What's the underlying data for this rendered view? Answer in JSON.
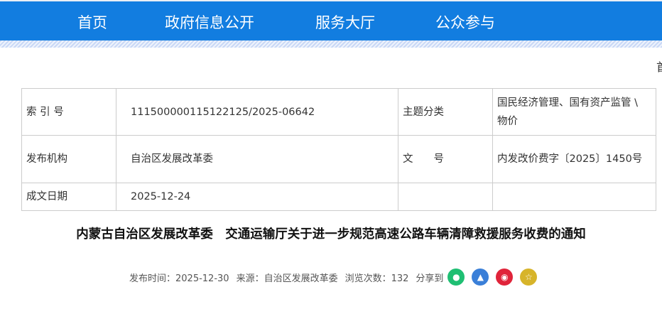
{
  "nav": [
    "首页",
    "政府信息公开",
    "服务大厅",
    "公众参与"
  ],
  "breadcrumb": "首",
  "info": {
    "index_label": "索 引 号",
    "index_value": "11150000011512212​5/2025-06642",
    "topic_label": "主题分类",
    "topic_value": "国民经济管理、国有资产监管 \\ 物价",
    "org_label": "发布机构",
    "org_value": "自治区发展改革委",
    "doc_label": "文　　号",
    "doc_value": "内发改价费字〔2025〕1450号",
    "date_label": "成文日期",
    "date_value": "2025-12-24"
  },
  "title": "内蒙古自治区发展改革委　交通运输厅关于进一步规范高速公路车辆清障救援服务收费的通知",
  "meta": {
    "publish": "发布时间：2025-12-30",
    "source": "来源：自治区发展改革委",
    "views": "浏览次数：132",
    "share": "分享到"
  },
  "colors": {
    "nav": "#127de0",
    "wechat": "#1fbf73",
    "qq": "#3a7fd8",
    "weibo": "#e0243a",
    "fav": "#d7b42a"
  }
}
